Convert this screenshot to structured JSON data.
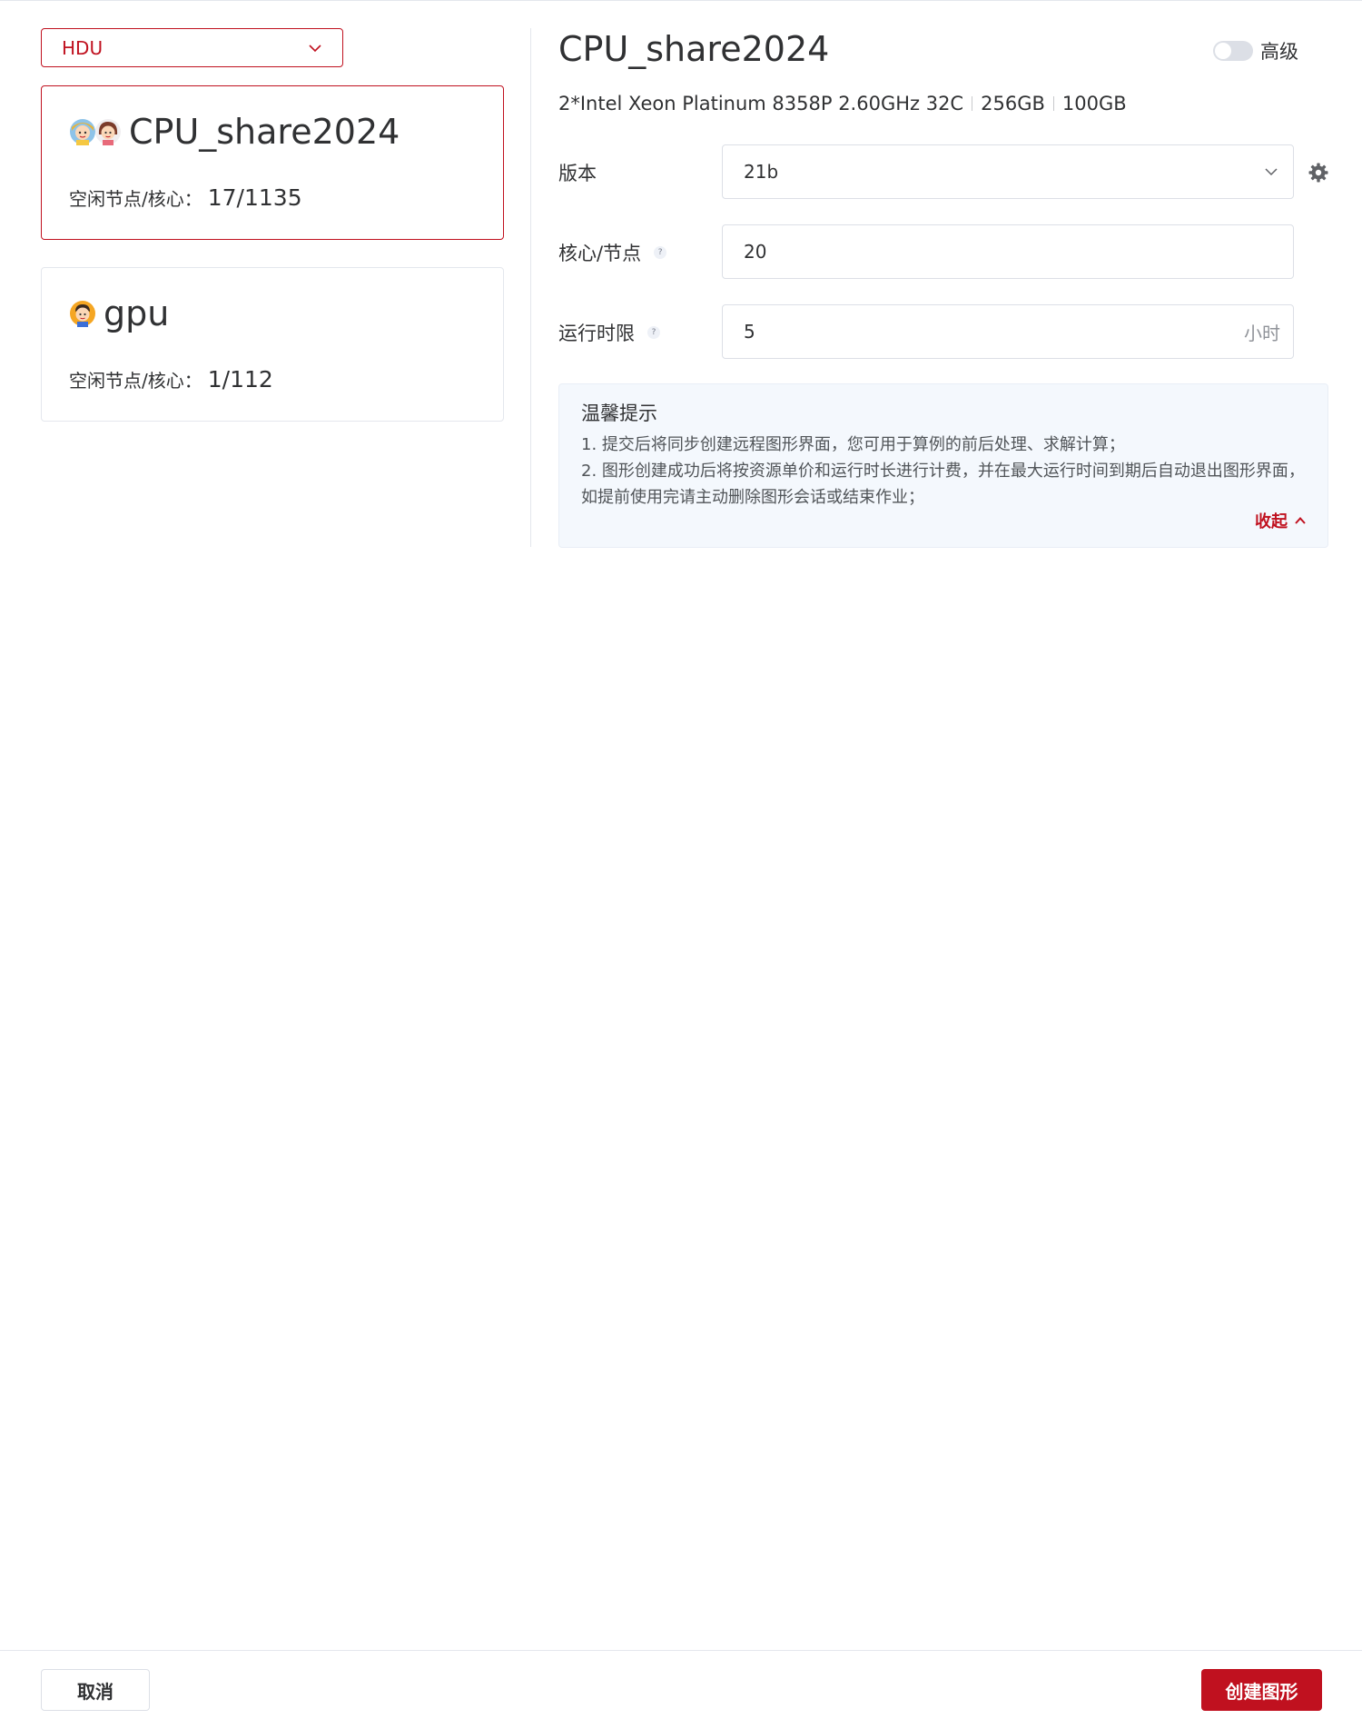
{
  "cluster_select": {
    "value": "HDU"
  },
  "queues": [
    {
      "name": "CPU_share2024",
      "stat_label": "空闲节点/核心：",
      "stat_value": "17/1135"
    },
    {
      "name": "gpu",
      "stat_label": "空闲节点/核心：",
      "stat_value": "1/112"
    }
  ],
  "detail": {
    "title": "CPU_share2024",
    "advanced_label": "高级",
    "advanced_enabled": false,
    "specs": [
      "2*Intel Xeon Platinum 8358P 2.60GHz 32C",
      "256GB",
      "100GB"
    ]
  },
  "form": {
    "version": {
      "label": "版本",
      "value": "21b"
    },
    "cores": {
      "label": "核心/节点",
      "value": "20"
    },
    "runtime": {
      "label": "运行时限",
      "value": "5",
      "unit": "小时"
    }
  },
  "tips": {
    "title": "温馨提示",
    "lines": [
      "1. 提交后将同步创建远程图形界面，您可用于算例的前后处理、求解计算；",
      "2. 图形创建成功后将按资源单价和运行时长进行计费，并在最大运行时间到期后自动退出图形界面，",
      "如提前使用完请主动删除图形会话或结束作业；"
    ],
    "collapse_label": "收起"
  },
  "footer": {
    "cancel_label": "取消",
    "create_label": "创建图形"
  },
  "colors": {
    "accent": "#c0111f",
    "border": "#dcdfe6",
    "tips_bg": "#f4f8fd"
  }
}
